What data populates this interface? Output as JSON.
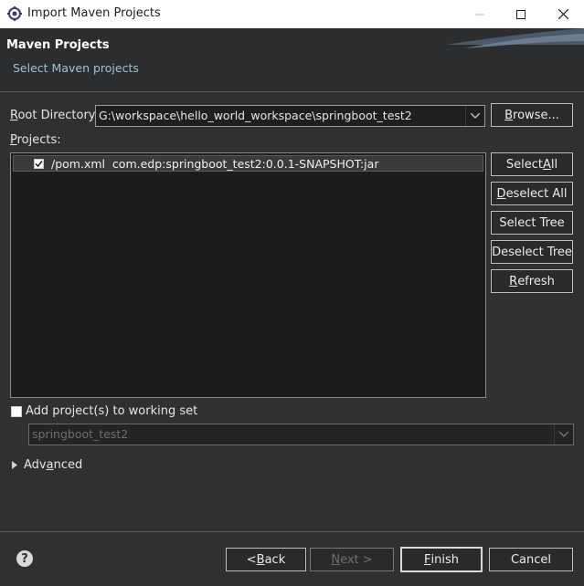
{
  "window": {
    "title": "Import Maven Projects"
  },
  "banner": {
    "heading": "Maven Projects",
    "subtitle": "Select Maven projects"
  },
  "root": {
    "label_pre": "",
    "label_u": "R",
    "label_post": "oot Directory:",
    "value": "G:\\workspace\\hello_world_workspace\\springboot_test2",
    "browse_u": "B",
    "browse_post": "rowse..."
  },
  "projects": {
    "label_u": "P",
    "label_post": "rojects:",
    "items": [
      {
        "text": "/pom.xml  com.edp:springboot_test2:0.0.1-SNAPSHOT:jar",
        "checked": true
      }
    ]
  },
  "side_buttons": {
    "select_all_pre": "Select ",
    "select_all_u": "A",
    "select_all_post": "ll",
    "deselect_all_u": "D",
    "deselect_all_post": "eselect All",
    "select_tree": "Select Tree",
    "deselect_tree": "Deselect Tree",
    "refresh_u": "R",
    "refresh_post": "efresh"
  },
  "working_set": {
    "label": "Add project(s) to working set",
    "checked": false,
    "value": "springboot_test2"
  },
  "advanced": {
    "label_pre": "Adv",
    "label_u": "a",
    "label_post": "nced"
  },
  "footer": {
    "back_pre": "< ",
    "back_u": "B",
    "back_post": "ack",
    "next_u": "N",
    "next_post": "ext >",
    "finish_u": "F",
    "finish_post": "inish",
    "cancel": "Cancel"
  }
}
